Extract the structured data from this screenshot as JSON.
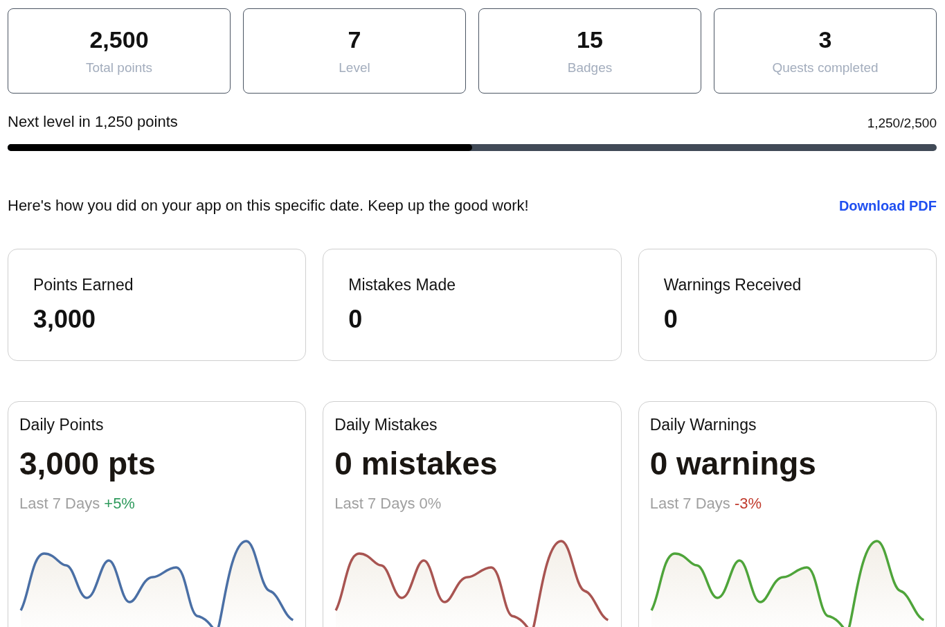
{
  "stats": [
    {
      "value": "2,500",
      "label": "Total points"
    },
    {
      "value": "7",
      "label": "Level"
    },
    {
      "value": "15",
      "label": "Badges"
    },
    {
      "value": "3",
      "label": "Quests completed"
    }
  ],
  "progress": {
    "label": "Next level in 1,250 points",
    "reading": "1,250/2,500",
    "level": 0.5
  },
  "message": {
    "text": "Here's how you did on your app on this specific date. Keep up the good work!",
    "link": "Download PDF"
  },
  "summary": [
    {
      "label": "Points Earned",
      "value": "3,000"
    },
    {
      "label": "Mistakes Made",
      "value": "0"
    },
    {
      "label": "Warnings Received",
      "value": "0"
    }
  ],
  "daily": [
    {
      "title": "Daily Points",
      "value": "3,000 pts",
      "period": "Last 7 Days",
      "change": "+5%",
      "kind": "up",
      "color": "#4a6fa5"
    },
    {
      "title": "Daily Mistakes",
      "value": "0 mistakes",
      "period": "Last 7 Days",
      "change": "0%",
      "kind": "flat",
      "color": "#a85451"
    },
    {
      "title": "Daily Warnings",
      "value": "0 warnings",
      "period": "Last 7 Days",
      "change": "-3%",
      "kind": "down",
      "color": "#4ea43a"
    }
  ]
}
